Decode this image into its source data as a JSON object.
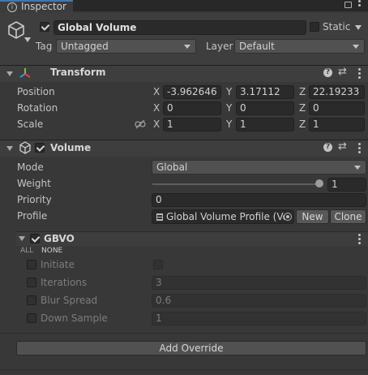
{
  "tab": {
    "title": "Inspector"
  },
  "gameobject": {
    "name": "Global Volume",
    "static_label": "Static",
    "tag_label": "Tag",
    "tag_value": "Untagged",
    "layer_label": "Layer",
    "layer_value": "Default"
  },
  "transform": {
    "title": "Transform",
    "position_label": "Position",
    "rotation_label": "Rotation",
    "scale_label": "Scale",
    "axis_x": "X",
    "axis_y": "Y",
    "axis_z": "Z",
    "position": {
      "x": "-3.962646",
      "y": "3.17112",
      "z": "22.19233"
    },
    "rotation": {
      "x": "0",
      "y": "0",
      "z": "0"
    },
    "scale": {
      "x": "1",
      "y": "1",
      "z": "1"
    }
  },
  "volume": {
    "title": "Volume",
    "mode_label": "Mode",
    "mode_value": "Global",
    "weight_label": "Weight",
    "weight_value": "1",
    "weight_fraction": 1.0,
    "priority_label": "Priority",
    "priority_value": "0",
    "profile_label": "Profile",
    "profile_value": "Global Volume Profile (Vo",
    "new_label": "New",
    "clone_label": "Clone"
  },
  "gbvo": {
    "title": "GBVO",
    "all_label": "ALL",
    "none_label": "NONE",
    "props": [
      {
        "label": "Initiate",
        "value": ""
      },
      {
        "label": "Iterations",
        "value": "3"
      },
      {
        "label": "Blur Spread",
        "value": "0.6"
      },
      {
        "label": "Down Sample",
        "value": "1"
      }
    ]
  },
  "add_override_label": "Add Override",
  "colors": {
    "background": "#383838",
    "header": "#3e3e3e",
    "field": "#2a2a2a",
    "button": "#585858"
  }
}
